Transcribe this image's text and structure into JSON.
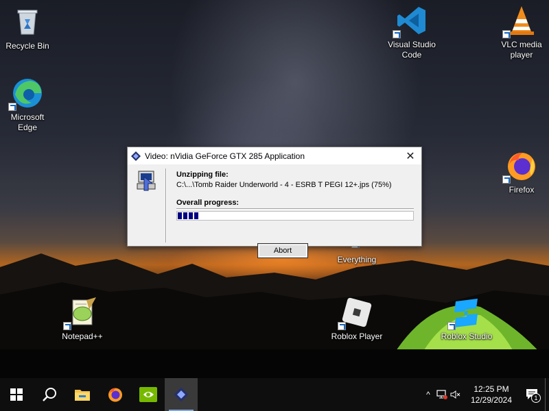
{
  "desktop": {
    "icons": [
      {
        "label": "Recycle Bin",
        "icon": "recycle-bin-icon"
      },
      {
        "label": "Microsoft Edge",
        "icon": "edge-icon"
      },
      {
        "label": "Visual Studio Code",
        "icon": "vscode-icon"
      },
      {
        "label": "VLC media player",
        "icon": "vlc-icon"
      },
      {
        "label": "Firefox",
        "icon": "firefox-icon"
      },
      {
        "label": "Everything",
        "icon": "everything-icon"
      },
      {
        "label": "Notepad++",
        "icon": "notepadpp-icon"
      },
      {
        "label": "Roblox Player",
        "icon": "roblox-player-icon"
      },
      {
        "label": "Roblox Studio",
        "icon": "roblox-studio-icon"
      }
    ]
  },
  "dialog": {
    "title": "Video: nVidia GeForce GTX 285 Application",
    "unzipping_label": "Unzipping file:",
    "file_path": "C:\\...\\Tomb Raider Underworld - 4 - ESRB T PEGI 12+.jps (75%)",
    "overall_label": "Overall progress:",
    "overall_progress": 0.1,
    "abort_label": "Abort",
    "close_glyph": "✕"
  },
  "taskbar": {
    "items": [
      {
        "name": "start-button",
        "icon": "windows-logo-icon"
      },
      {
        "name": "search-button",
        "icon": "search-icon"
      },
      {
        "name": "file-explorer",
        "icon": "folder-icon"
      },
      {
        "name": "firefox",
        "icon": "firefox-icon"
      },
      {
        "name": "nvidia",
        "icon": "nvidia-icon"
      },
      {
        "name": "installer-app",
        "icon": "installer-icon",
        "active": true
      }
    ],
    "time": "12:25 PM",
    "date": "12/29/2024",
    "notification_count": "1",
    "tray_chevron": "^"
  },
  "colors": {
    "progress_fill": "#000080",
    "taskbar_bg": "#0e0e0e",
    "dialog_bg": "#f0f0f0"
  }
}
